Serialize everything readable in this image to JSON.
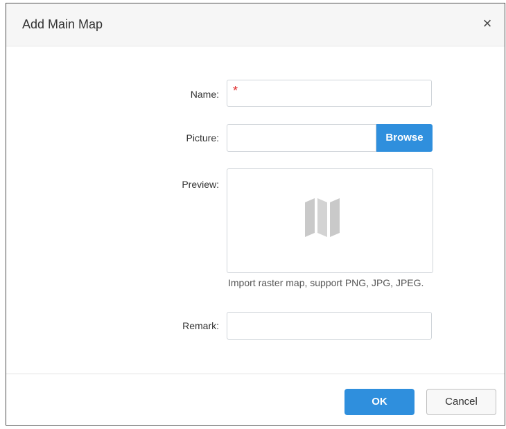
{
  "dialog": {
    "title": "Add Main Map",
    "close_glyph": "×"
  },
  "form": {
    "name": {
      "label": "Name:",
      "value": "",
      "required_marker": "*"
    },
    "picture": {
      "label": "Picture:",
      "value": "",
      "button_label": "Browse"
    },
    "preview": {
      "label": "Preview:",
      "icon": "map-icon",
      "hint": "Import raster map, support PNG, JPG, JPEG."
    },
    "remark": {
      "label": "Remark:",
      "value": ""
    }
  },
  "footer": {
    "ok_label": "OK",
    "cancel_label": "Cancel"
  },
  "colors": {
    "primary": "#2f8fdd",
    "required": "#e03131",
    "icon_gray": "#c9c9c9"
  }
}
